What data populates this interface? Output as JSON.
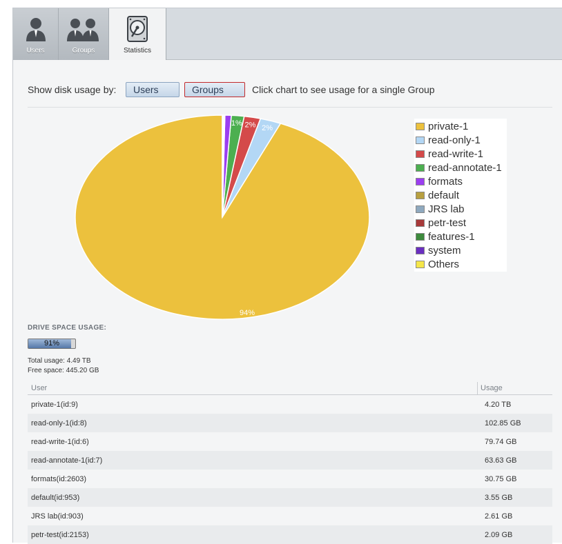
{
  "tabs": [
    {
      "label": "Users",
      "icon": "user-icon"
    },
    {
      "label": "Groups",
      "icon": "groups-icon"
    },
    {
      "label": "Statistics",
      "icon": "hard-drive-icon"
    }
  ],
  "controls": {
    "show_label": "Show disk usage by:",
    "users_button": "Users",
    "groups_button": "Groups",
    "hint": "Click chart to see usage for a single Group"
  },
  "chart_data": {
    "type": "pie",
    "slices": [
      {
        "name": "private-1",
        "value": 93.6,
        "label": "94%",
        "color": "#ecc13d"
      },
      {
        "name": "read-only-1",
        "value": 2.3,
        "label": "2%",
        "color": "#b3d7f5"
      },
      {
        "name": "read-write-1",
        "value": 1.8,
        "label": "2%",
        "color": "#d44a4a"
      },
      {
        "name": "read-annotate-1",
        "value": 1.4,
        "label": "1%",
        "color": "#4caf50"
      },
      {
        "name": "formats",
        "value": 0.7,
        "label": "",
        "color": "#9b3ef0"
      },
      {
        "name": "default",
        "value": 0.08,
        "label": "",
        "color": "#b8a040"
      },
      {
        "name": "JRS lab",
        "value": 0.06,
        "label": "",
        "color": "#8fa9bf"
      },
      {
        "name": "petr-test",
        "value": 0.05,
        "label": "",
        "color": "#a83a3a"
      },
      {
        "name": "features-1",
        "value": 0.04,
        "label": "",
        "color": "#3d8a3d"
      },
      {
        "name": "system",
        "value": 0.03,
        "label": "",
        "color": "#6a2fc0"
      },
      {
        "name": "Others",
        "value": 0.02,
        "label": "",
        "color": "#f5e64a"
      }
    ]
  },
  "drive": {
    "title": "DRIVE SPACE USAGE:",
    "percent": 91,
    "percent_label": "91%",
    "total": "Total usage: 4.49 TB",
    "free": "Free space: 445.20 GB"
  },
  "table": {
    "col_user": "User",
    "col_usage": "Usage",
    "rows": [
      {
        "user": "private-1(id:9)",
        "usage": "4.20 TB"
      },
      {
        "user": "read-only-1(id:8)",
        "usage": "102.85 GB"
      },
      {
        "user": "read-write-1(id:6)",
        "usage": "79.74 GB"
      },
      {
        "user": "read-annotate-1(id:7)",
        "usage": "63.63 GB"
      },
      {
        "user": "formats(id:2603)",
        "usage": "30.75 GB"
      },
      {
        "user": "default(id:953)",
        "usage": "3.55 GB"
      },
      {
        "user": "JRS lab(id:903)",
        "usage": "2.61 GB"
      },
      {
        "user": "petr-test(id:2153)",
        "usage": "2.09 GB"
      }
    ]
  }
}
